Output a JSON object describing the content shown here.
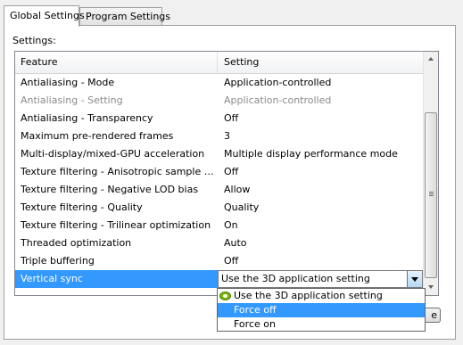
{
  "tabs": [
    {
      "label": "Global Settings",
      "active": true
    },
    {
      "label": "Program Settings",
      "active": false
    }
  ],
  "settings_label": "Settings:",
  "grid": {
    "columns": [
      "Feature",
      "Setting"
    ],
    "rows": [
      {
        "feature": "Antialiasing - Mode",
        "setting": "Application-controlled"
      },
      {
        "feature": "Antialiasing - Setting",
        "setting": "Application-controlled",
        "disabled": true
      },
      {
        "feature": "Antialiasing - Transparency",
        "setting": "Off"
      },
      {
        "feature": "Maximum pre-rendered frames",
        "setting": "3"
      },
      {
        "feature": "Multi-display/mixed-GPU acceleration",
        "setting": "Multiple display performance mode"
      },
      {
        "feature": "Texture filtering - Anisotropic sample optimization",
        "setting": "Off"
      },
      {
        "feature": "Texture filtering - Negative LOD bias",
        "setting": "Allow"
      },
      {
        "feature": "Texture filtering - Quality",
        "setting": "Quality"
      },
      {
        "feature": "Texture filtering - Trilinear optimization",
        "setting": "On"
      },
      {
        "feature": "Threaded optimization",
        "setting": "Auto"
      },
      {
        "feature": "Triple buffering",
        "setting": "Off"
      },
      {
        "feature": "Vertical sync",
        "setting": "Use the 3D application setting",
        "selected": true
      }
    ]
  },
  "dropdown": {
    "options": [
      "Use the 3D application setting",
      "Force off",
      "Force on"
    ],
    "highlighted_index": 1,
    "first_option_icon": "nvidia-logo-icon"
  },
  "partial_button_label": "e",
  "colors": {
    "selection": "#3399ff",
    "nvidia_green": "#76b900"
  }
}
